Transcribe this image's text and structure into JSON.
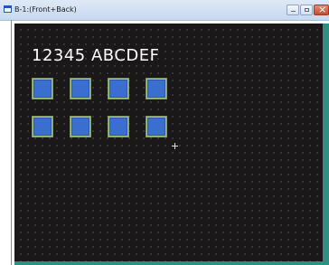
{
  "window": {
    "title": "B-1:(Front+Back)"
  },
  "screen": {
    "display_text": "12345 ABCDEF",
    "lamp_rows": 2,
    "lamps_per_row": 4,
    "lamp_color": "#3a6fd0",
    "background_color": "#1a1818",
    "edge_color": "#2f8f83"
  }
}
